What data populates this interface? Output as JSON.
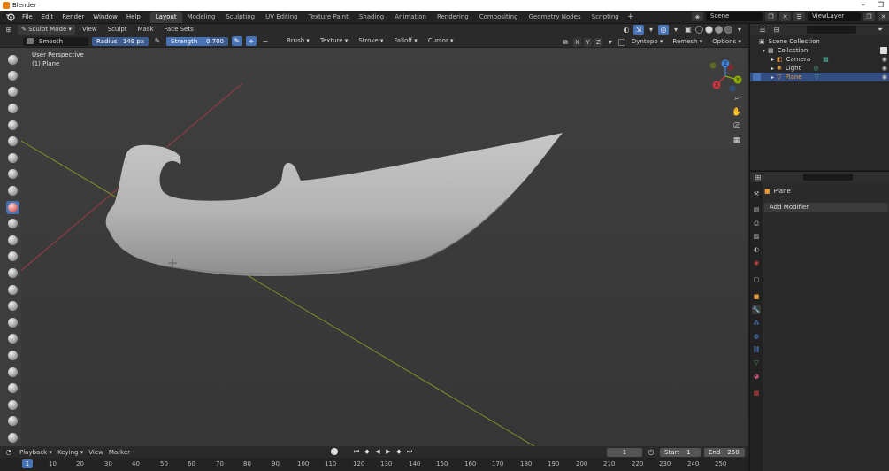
{
  "window": {
    "title": "Blender",
    "controls": [
      "–",
      "❐"
    ]
  },
  "menu": [
    "File",
    "Edit",
    "Render",
    "Window",
    "Help"
  ],
  "workspaces": [
    {
      "label": "Layout",
      "active": true
    },
    {
      "label": "Modeling"
    },
    {
      "label": "Sculpting"
    },
    {
      "label": "UV Editing"
    },
    {
      "label": "Texture Paint"
    },
    {
      "label": "Shading"
    },
    {
      "label": "Animation"
    },
    {
      "label": "Rendering"
    },
    {
      "label": "Compositing"
    },
    {
      "label": "Geometry Nodes"
    },
    {
      "label": "Scripting"
    }
  ],
  "scene": {
    "name": "Scene",
    "view_layer": "ViewLayer"
  },
  "viewport_header": {
    "mode": "Sculpt Mode",
    "menus": [
      "View",
      "Sculpt",
      "Mask",
      "Face Sets"
    ]
  },
  "tool_settings": {
    "brush": "Smooth",
    "radius_label": "Radius",
    "radius_value": "149 px",
    "strength_label": "Strength",
    "strength_value": "0.700",
    "strength_fraction": 0.7,
    "menus": [
      "Brush",
      "Texture",
      "Stroke",
      "Falloff",
      "Cursor"
    ],
    "axes": [
      "X",
      "Y",
      "Z"
    ],
    "dyntopo": "Dyntopo",
    "remesh": "Remesh",
    "options": "Options"
  },
  "viewport": {
    "perspective": "User Perspective",
    "object": "(1) Plane",
    "gizmo_axes": [
      "X",
      "Y",
      "Z"
    ]
  },
  "timeline": {
    "menus": [
      "Playback",
      "Keying",
      "View",
      "Marker"
    ],
    "current_frame": "1",
    "start_label": "Start",
    "start": "1",
    "end_label": "End",
    "end": "250",
    "ruler_current": "1",
    "ticks": [
      "10",
      "20",
      "30",
      "40",
      "50",
      "60",
      "70",
      "80",
      "90",
      "100",
      "110",
      "120",
      "130",
      "140",
      "150",
      "160",
      "170",
      "180",
      "190",
      "200",
      "210",
      "220",
      "230",
      "240",
      "250"
    ]
  },
  "outliner": {
    "items": [
      {
        "label": "Scene Collection",
        "level": 0
      },
      {
        "label": "Collection",
        "level": 1
      },
      {
        "label": "Camera",
        "level": 2
      },
      {
        "label": "Light",
        "level": 2
      },
      {
        "label": "Plane",
        "level": 2,
        "selected": true
      }
    ]
  },
  "properties": {
    "object_name": "Plane",
    "add_modifier": "Add Modifier"
  },
  "colors": {
    "accent": "#4772b3",
    "x_axis": "#c8363f",
    "y_axis": "#8cb000",
    "z_axis": "#3f80d8"
  }
}
